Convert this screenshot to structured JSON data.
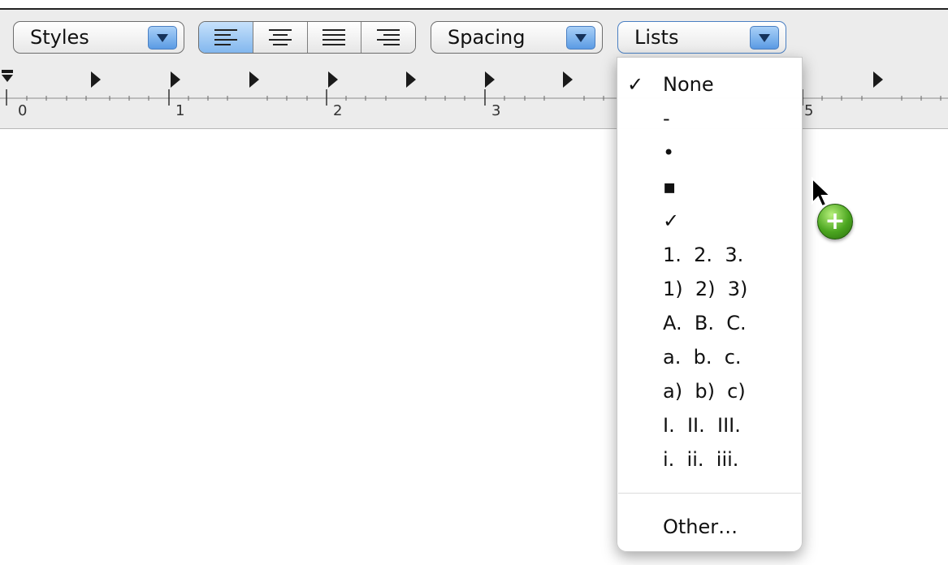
{
  "toolbar": {
    "styles_label": "Styles",
    "spacing_label": "Spacing",
    "lists_label": "Lists",
    "alignment_buttons": [
      "align-left",
      "align-center",
      "align-justify",
      "align-right"
    ],
    "active_alignment": "align-left"
  },
  "ruler": {
    "labels": [
      "0",
      "1",
      "2",
      "3",
      "5"
    ]
  },
  "lists_menu": {
    "items": [
      {
        "label": "None",
        "checked": true
      },
      {
        "label": "-",
        "checked": false
      },
      {
        "label": "•",
        "checked": false
      },
      {
        "label": "▪",
        "checked": false
      },
      {
        "label": "✓",
        "checked": false
      },
      {
        "label": "1.  2.  3.",
        "checked": false
      },
      {
        "label": "1)  2)  3)",
        "checked": false
      },
      {
        "label": "A.  B.  C.",
        "checked": false
      },
      {
        "label": "a.  b.  c.",
        "checked": false
      },
      {
        "label": "a)  b)  c)",
        "checked": false
      },
      {
        "label": "I.  II.  III.",
        "checked": false
      },
      {
        "label": "i.  ii.  iii.",
        "checked": false
      }
    ],
    "other_label": "Other…",
    "check_mark": "✓"
  },
  "cursor": {
    "badge_symbol": "+",
    "icon": "copy-cursor-icon"
  },
  "colors": {
    "accent_blue": "#5b9be4",
    "toolbar_bg": "#ececec",
    "badge_green": "#4aa51f"
  }
}
